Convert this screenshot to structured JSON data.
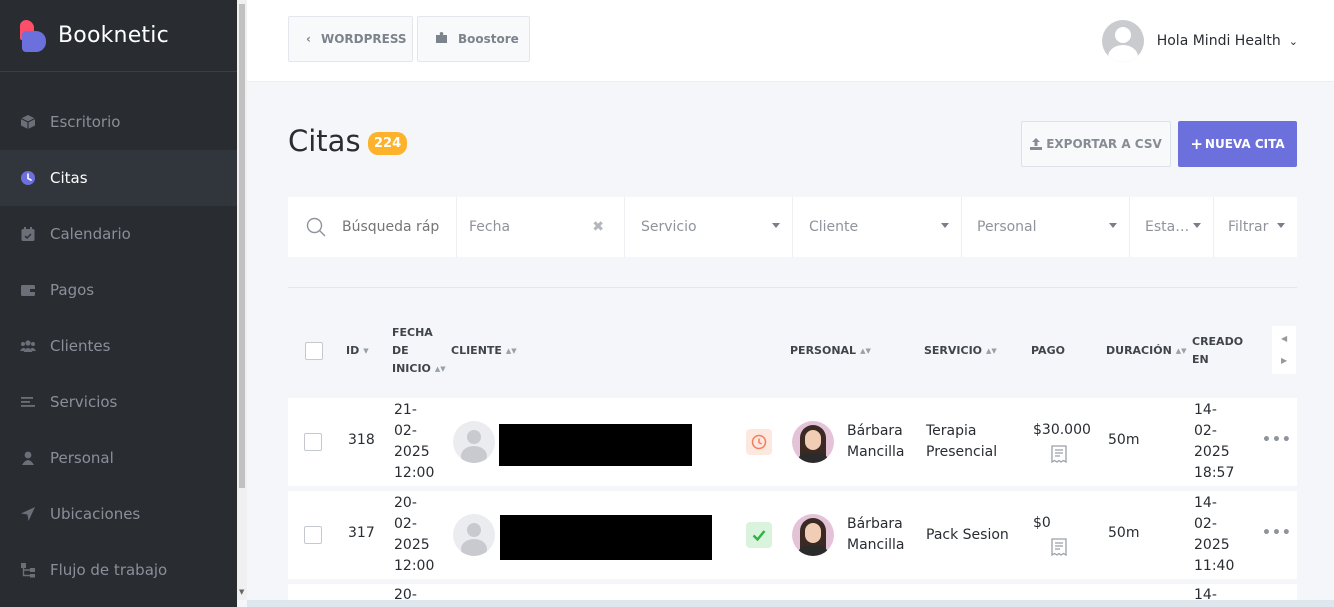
{
  "brand": {
    "name": "Booknetic"
  },
  "sidebar": {
    "items": [
      {
        "label": "Escritorio",
        "icon": "cube-icon"
      },
      {
        "label": "Citas",
        "icon": "clock-icon",
        "active": true
      },
      {
        "label": "Calendario",
        "icon": "calendar-icon"
      },
      {
        "label": "Pagos",
        "icon": "wallet-icon"
      },
      {
        "label": "Clientes",
        "icon": "users-icon"
      },
      {
        "label": "Servicios",
        "icon": "list-icon"
      },
      {
        "label": "Personal",
        "icon": "user-icon"
      },
      {
        "label": "Ubicaciones",
        "icon": "location-arrow-icon"
      },
      {
        "label": "Flujo de trabajo",
        "icon": "workflow-icon"
      }
    ]
  },
  "topbar": {
    "back_label": "WORDPRESS",
    "store_label": "Boostore",
    "user_name": "Hola Mindi Health"
  },
  "page": {
    "title": "Citas",
    "count": "224",
    "export_label": "EXPORTAR A CSV",
    "new_label": "NUEVA CITA"
  },
  "filters": {
    "search_placeholder": "Búsqueda ráp",
    "date_placeholder": "Fecha",
    "service": "Servicio",
    "client": "Cliente",
    "staff": "Personal",
    "status": "Esta…",
    "filter": "Filtrar"
  },
  "table": {
    "headers": {
      "id": "ID",
      "start_date": [
        "FECHA",
        "DE",
        "INICIO"
      ],
      "client": "CLIENTE",
      "staff": "PERSONAL",
      "service": "SERVICIO",
      "payment": "PAGO",
      "duration": "DURACIÓN",
      "created": [
        "CREADO",
        "EN"
      ]
    },
    "rows": [
      {
        "id": "318",
        "date": [
          "21-",
          "02-",
          "2025",
          "12:00"
        ],
        "status": "pending",
        "status_icon": "clock-icon",
        "staff": [
          "Bárbara",
          "Mancilla"
        ],
        "service": [
          "Terapia",
          "Presencial"
        ],
        "payment": "$30.000",
        "duration": "50m",
        "created": [
          "14-",
          "02-",
          "2025",
          "18:57"
        ]
      },
      {
        "id": "317",
        "date": [
          "20-",
          "02-",
          "2025",
          "12:00"
        ],
        "status": "approved",
        "status_icon": "check-icon",
        "staff": [
          "Bárbara",
          "Mancilla"
        ],
        "service": [
          "Pack Sesion"
        ],
        "payment": "$0",
        "duration": "50m",
        "created": [
          "14-",
          "02-",
          "2025",
          "11:40"
        ]
      },
      {
        "id": "",
        "date": [
          "20-"
        ],
        "created": [
          "14-"
        ]
      }
    ]
  },
  "colors": {
    "sidebar_bg": "#292d32",
    "accent": "#6c70dc",
    "badge": "#fdb22b",
    "pending_bg": "#fde8e0",
    "approved_bg": "#d9f3dc"
  }
}
